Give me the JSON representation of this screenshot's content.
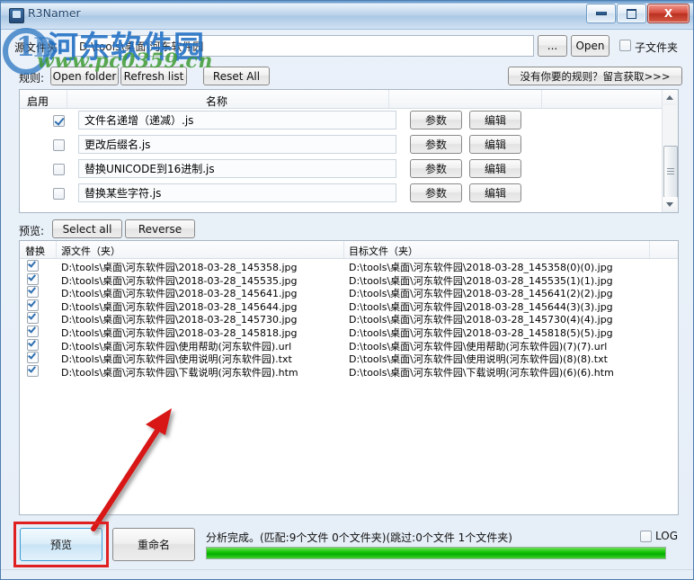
{
  "window": {
    "title": "R3Namer",
    "minimize_label": "minimize",
    "maximize_label": "maximize",
    "close_label": "X"
  },
  "watermark": {
    "brand_cn": "河东软件园",
    "url": "www.pc0359.cn",
    "logo_digit": "1",
    "logo_letter": "D"
  },
  "source": {
    "label": "源文件夹：",
    "path": "D:\\tools\\桌面\\河东软件园",
    "browse_label": "...",
    "open_label": "Open",
    "subfolder_label": "子文件夹",
    "subfolder_checked": false
  },
  "rules": {
    "label": "规则:",
    "open_folder_label": "Open folder",
    "refresh_list_label": "Refresh list",
    "reset_all_label": "Reset All",
    "get_rule_label": "没有你要的规则？留言获取>>>",
    "columns": {
      "enable": "启用",
      "name": "名称"
    },
    "items": [
      {
        "name": "文件名递增（递减）.js",
        "checked": true,
        "param_label": "参数",
        "edit_label": "编辑"
      },
      {
        "name": "更改后缀名.js",
        "checked": false,
        "param_label": "参数",
        "edit_label": "编辑"
      },
      {
        "name": "替换UNICODE到16进制.js",
        "checked": false,
        "param_label": "参数",
        "edit_label": "编辑"
      },
      {
        "name": "替换某些字符.js",
        "checked": false,
        "param_label": "参数",
        "edit_label": "编辑"
      }
    ]
  },
  "preview": {
    "label": "预览:",
    "select_all_label": "Select all",
    "reverse_label": "Reverse",
    "columns": {
      "replace": "替换",
      "source": "源文件（夹）",
      "target": "目标文件（夹）"
    },
    "rows": [
      {
        "checked": true,
        "source": "D:\\tools\\桌面\\河东软件园\\2018-03-28_145358.jpg",
        "target": "D:\\tools\\桌面\\河东软件园\\2018-03-28_145358(0)(0).jpg"
      },
      {
        "checked": true,
        "source": "D:\\tools\\桌面\\河东软件园\\2018-03-28_145535.jpg",
        "target": "D:\\tools\\桌面\\河东软件园\\2018-03-28_145535(1)(1).jpg"
      },
      {
        "checked": true,
        "source": "D:\\tools\\桌面\\河东软件园\\2018-03-28_145641.jpg",
        "target": "D:\\tools\\桌面\\河东软件园\\2018-03-28_145641(2)(2).jpg"
      },
      {
        "checked": true,
        "source": "D:\\tools\\桌面\\河东软件园\\2018-03-28_145644.jpg",
        "target": "D:\\tools\\桌面\\河东软件园\\2018-03-28_145644(3)(3).jpg"
      },
      {
        "checked": true,
        "source": "D:\\tools\\桌面\\河东软件园\\2018-03-28_145730.jpg",
        "target": "D:\\tools\\桌面\\河东软件园\\2018-03-28_145730(4)(4).jpg"
      },
      {
        "checked": true,
        "source": "D:\\tools\\桌面\\河东软件园\\2018-03-28_145818.jpg",
        "target": "D:\\tools\\桌面\\河东软件园\\2018-03-28_145818(5)(5).jpg"
      },
      {
        "checked": true,
        "source": "D:\\tools\\桌面\\河东软件园\\使用帮助(河东软件园).url",
        "target": "D:\\tools\\桌面\\河东软件园\\使用帮助(河东软件园)(7)(7).url"
      },
      {
        "checked": true,
        "source": "D:\\tools\\桌面\\河东软件园\\使用说明(河东软件园).txt",
        "target": "D:\\tools\\桌面\\河东软件园\\使用说明(河东软件园)(8)(8).txt"
      },
      {
        "checked": true,
        "source": "D:\\tools\\桌面\\河东软件园\\下载说明(河东软件园).htm",
        "target": "D:\\tools\\桌面\\河东软件园\\下载说明(河东软件园)(6)(6).htm"
      }
    ]
  },
  "footer": {
    "preview_button": "预览",
    "rename_button": "重命名",
    "status": "分析完成。(匹配:9个文件 0个文件夹)(跳过:0个文件 1个文件夹)",
    "log_label": "LOG",
    "log_checked": false,
    "progress_percent": 100
  },
  "annotation": {
    "highlight_color": "#e02020",
    "arrow_color": "#d81818"
  }
}
